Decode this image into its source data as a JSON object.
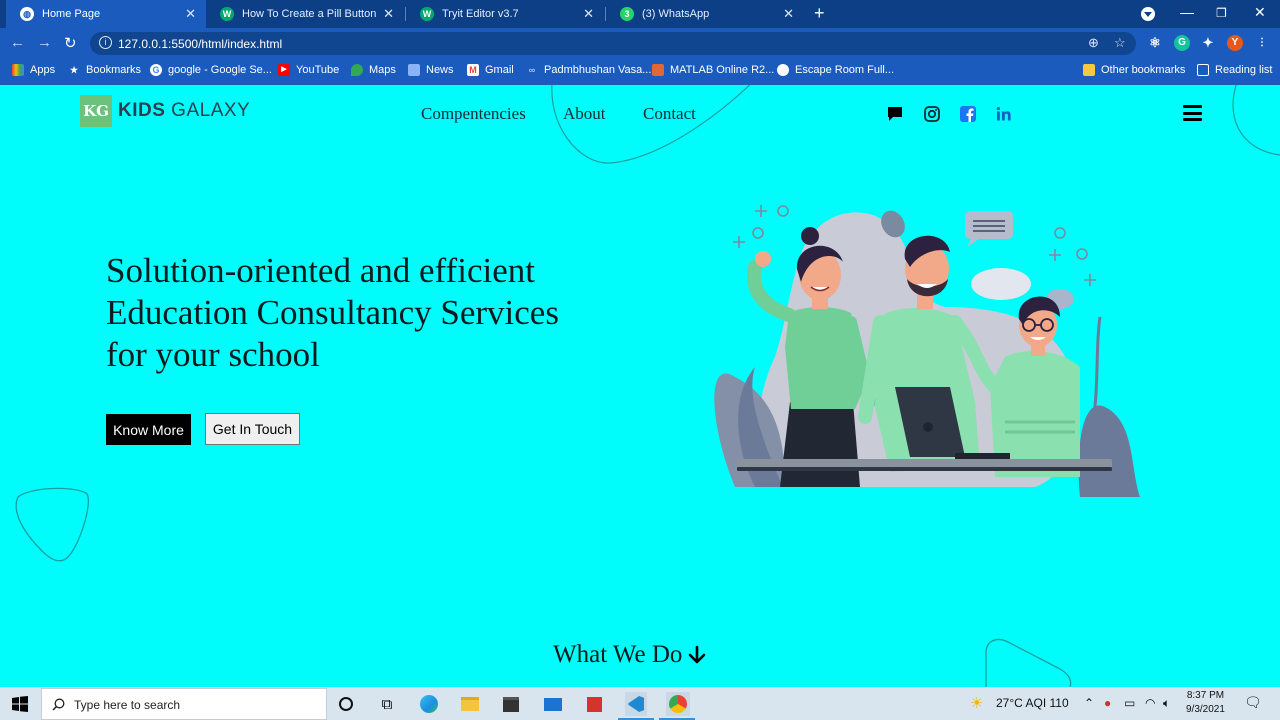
{
  "browser": {
    "tabs": [
      {
        "title": "Home Page",
        "active": true,
        "icon": "globe-icon"
      },
      {
        "title": "How To Create a Pill Button",
        "active": false,
        "icon": "w3schools-icon"
      },
      {
        "title": "Tryit Editor v3.7",
        "active": false,
        "icon": "w3schools-icon"
      },
      {
        "title": "(3) WhatsApp",
        "active": false,
        "icon": "whatsapp-icon"
      }
    ],
    "url": "127.0.0.1:5500/html/index.html",
    "profile_initial": "Y",
    "bookmarks": [
      {
        "label": "Apps",
        "icon": "apps-grid-icon"
      },
      {
        "label": "Bookmarks",
        "icon": "star-icon"
      },
      {
        "label": "google - Google Se...",
        "icon": "google-icon"
      },
      {
        "label": "YouTube",
        "icon": "youtube-icon"
      },
      {
        "label": "Maps",
        "icon": "maps-icon"
      },
      {
        "label": "News",
        "icon": "news-icon"
      },
      {
        "label": "Gmail",
        "icon": "gmail-icon"
      },
      {
        "label": "Padmbhushan Vasa...",
        "icon": "link-icon"
      },
      {
        "label": "MATLAB Online R2...",
        "icon": "matlab-icon"
      },
      {
        "label": "Escape Room Full...",
        "icon": "chrome-icon"
      }
    ],
    "other_bookmarks": "Other bookmarks",
    "reading_list": "Reading list"
  },
  "site": {
    "logo_mark": "KG",
    "logo_bold": "KIDS",
    "logo_light": " GALAXY",
    "nav": [
      "Compentencies",
      "About",
      "Contact"
    ],
    "social_icons": [
      "chat-icon",
      "instagram-icon",
      "facebook-icon",
      "linkedin-icon"
    ],
    "hero_title": "Solution-oriented and efficient Education Consultancy Services for your school",
    "btn_primary": "Know More",
    "btn_secondary": "Get In Touch",
    "section_title": "What We Do"
  },
  "taskbar": {
    "search_placeholder": "Type here to search",
    "weather": "27°C  AQI 110",
    "time": "8:37 PM",
    "date": "9/3/2021"
  },
  "colors": {
    "page_bg": "#00fdfb",
    "chrome_tab_bg": "#0c3f86",
    "chrome_bar_bg": "#1a5bbd",
    "accent_green": "#6bc27b",
    "facebook_blue": "#1877f2",
    "linkedin_blue": "#0a66c2"
  }
}
